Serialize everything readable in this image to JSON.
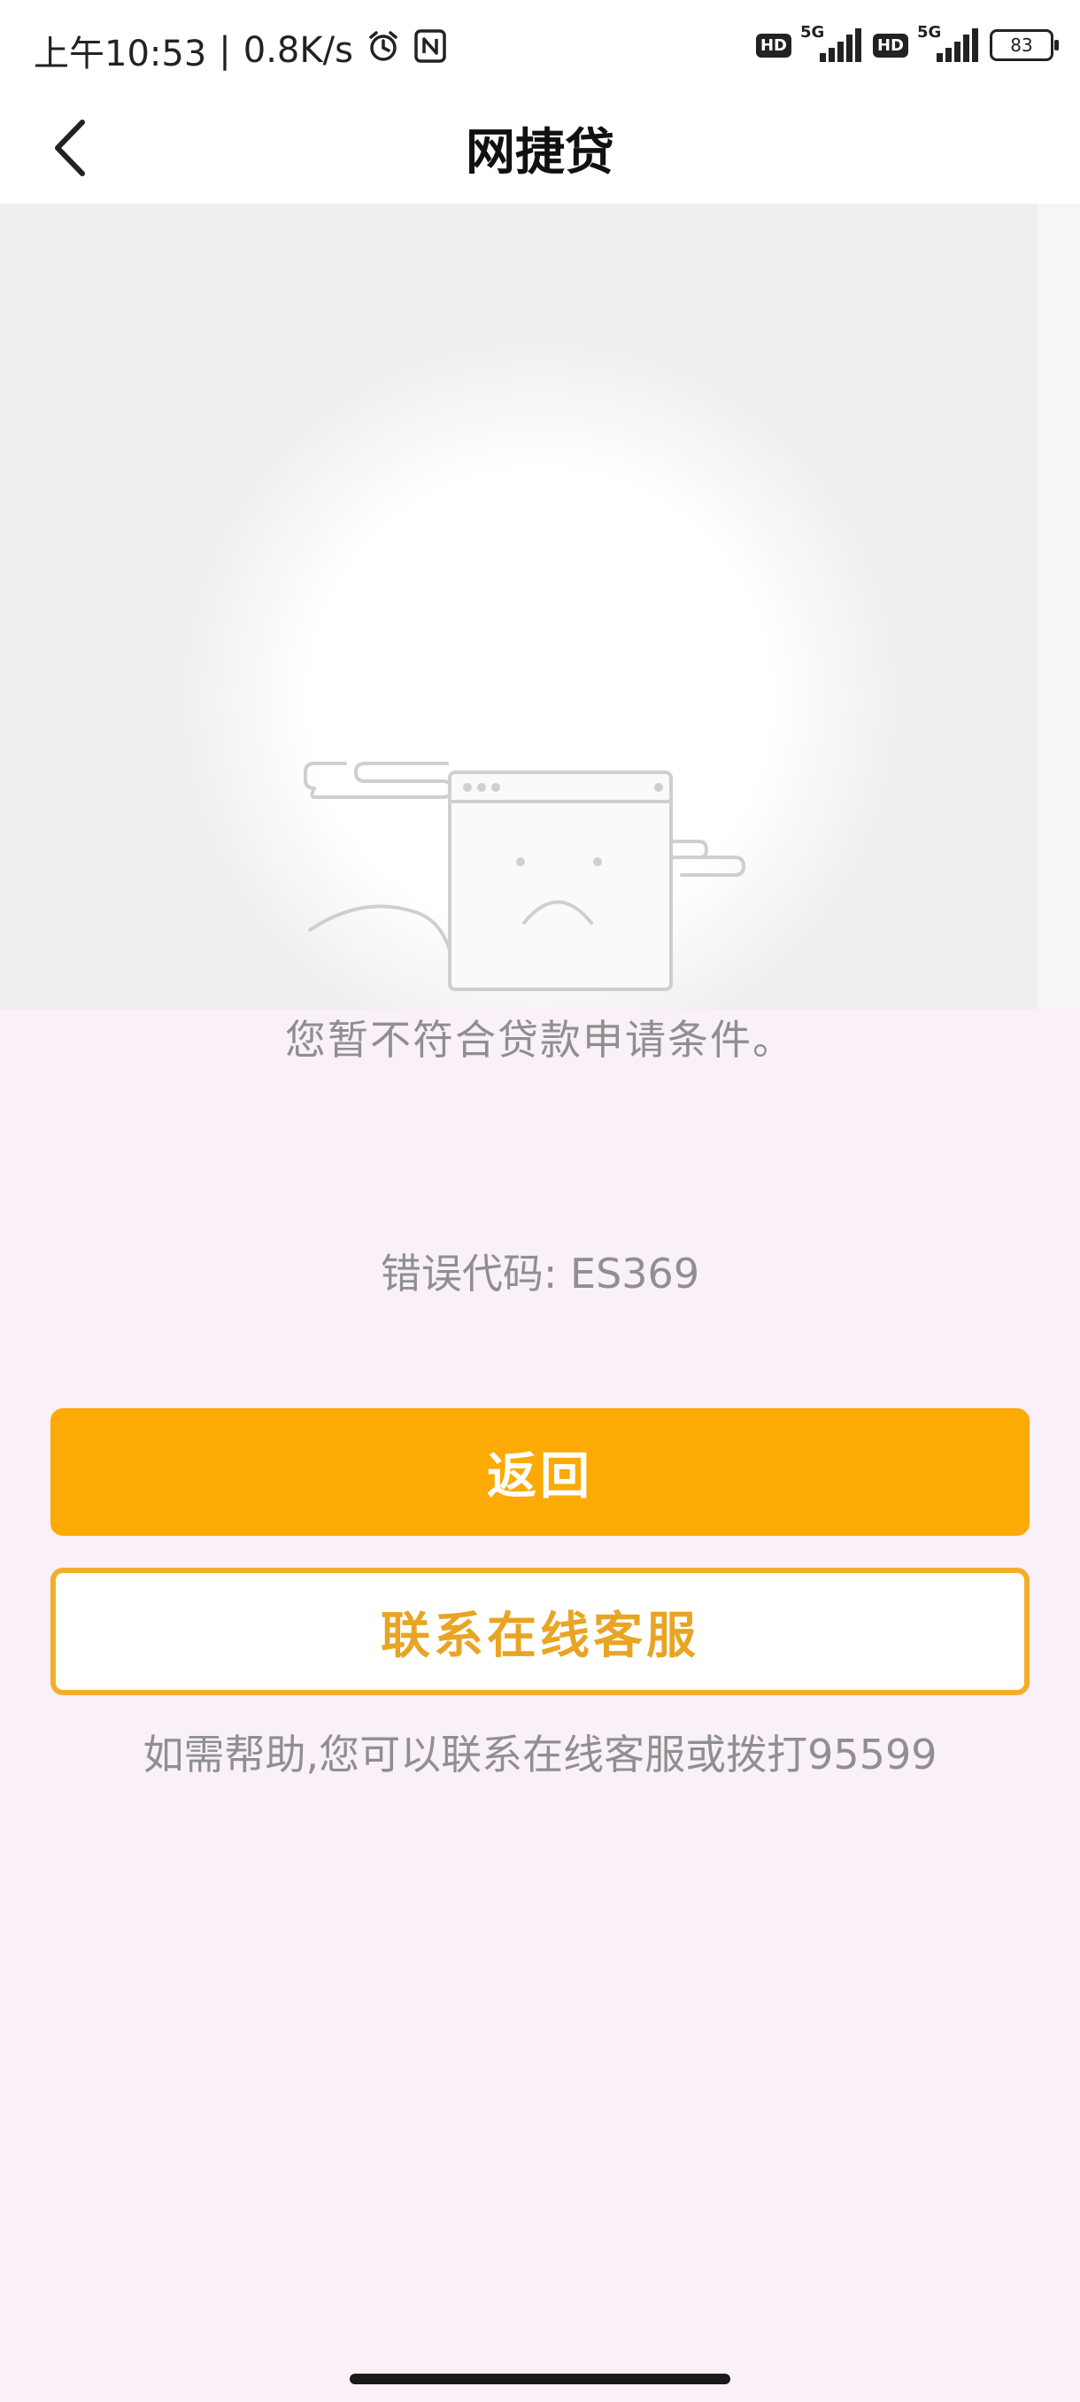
{
  "status_bar": {
    "time": "上午10:53",
    "separator": "|",
    "network_speed": "0.8K/s",
    "hd_label_1": "HD",
    "hd_label_2": "HD",
    "network_type_1": "5G",
    "network_type_2": "5G",
    "battery_level": "83",
    "icons": [
      "alarm-icon",
      "nfc-icon",
      "signal-icon",
      "battery-icon"
    ]
  },
  "nav": {
    "title": "网捷贷",
    "back_icon": "chevron-left-icon"
  },
  "illustration": {
    "icon": "sad-browser-window-icon"
  },
  "content": {
    "message": "您暂不符合贷款申请条件。",
    "error_code": "错误代码: ES369",
    "return_button": "返回",
    "contact_button": "联系在线客服",
    "help_text": "如需帮助,您可以联系在线客服或拨打95599"
  },
  "colors": {
    "primary": "#fbaa06",
    "outline": "#f0ae2b",
    "page_background": "#f9f0f9",
    "text_gray": "#8f8f8f"
  }
}
